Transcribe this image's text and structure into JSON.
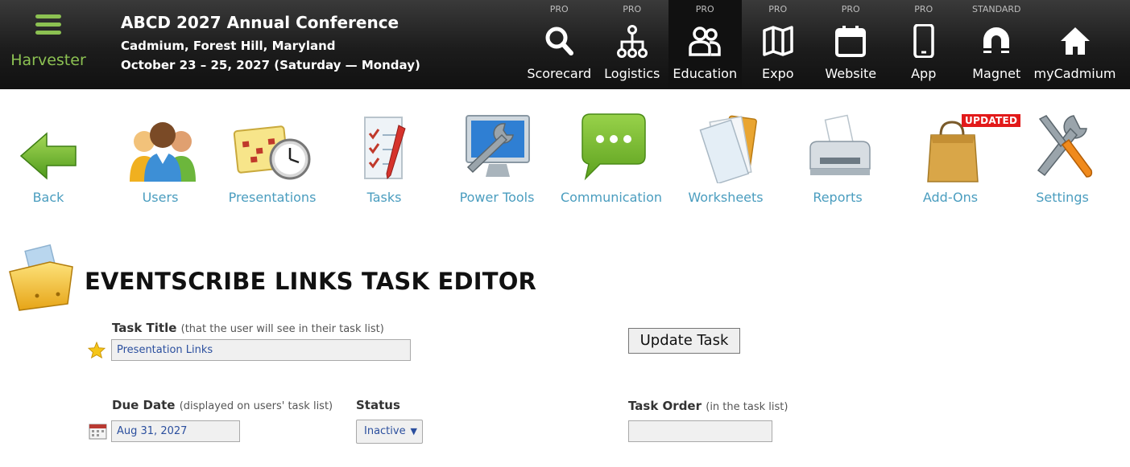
{
  "brand": {
    "name": "Harvester"
  },
  "event": {
    "title": "ABCD 2027 Annual Conference",
    "location": "Cadmium, Forest Hill, Maryland",
    "dates": "October 23 – 25, 2027 (Saturday — Monday)"
  },
  "nav": [
    {
      "tier": "PRO",
      "label": "Scorecard",
      "icon": "search-icon"
    },
    {
      "tier": "PRO",
      "label": "Logistics",
      "icon": "org-chart-icon"
    },
    {
      "tier": "PRO",
      "label": "Education",
      "icon": "people-icon",
      "active": true
    },
    {
      "tier": "PRO",
      "label": "Expo",
      "icon": "map-icon"
    },
    {
      "tier": "PRO",
      "label": "Website",
      "icon": "calendar-icon"
    },
    {
      "tier": "PRO",
      "label": "App",
      "icon": "phone-icon"
    },
    {
      "tier": "STANDARD",
      "label": "Magnet",
      "icon": "magnet-icon"
    },
    {
      "tier": "",
      "label": "myCadmium",
      "icon": "home-icon"
    }
  ],
  "toolbar": [
    {
      "label": "Back",
      "icon": "back-arrow-icon"
    },
    {
      "label": "Users",
      "icon": "users-icon"
    },
    {
      "label": "Presentations",
      "icon": "calendar-clock-icon"
    },
    {
      "label": "Tasks",
      "icon": "checklist-icon"
    },
    {
      "label": "Power Tools",
      "icon": "monitor-wrench-icon"
    },
    {
      "label": "Communication",
      "icon": "chat-bubble-icon"
    },
    {
      "label": "Worksheets",
      "icon": "documents-icon"
    },
    {
      "label": "Reports",
      "icon": "printer-icon"
    },
    {
      "label": "Add-Ons",
      "icon": "shopping-bag-icon",
      "badge": "UPDATED"
    },
    {
      "label": "Settings",
      "icon": "tools-icon"
    }
  ],
  "editor": {
    "title": "EVENTSCRIBE LINKS TASK EDITOR",
    "task_title_label": "Task Title",
    "task_title_hint": "(that the user will see in their task list)",
    "task_title_value": "Presentation Links",
    "update_button": "Update Task",
    "due_date_label": "Due Date",
    "due_date_hint": "(displayed on users' task list)",
    "due_date_value": "Aug 31, 2027",
    "status_label": "Status",
    "status_value": "Inactive",
    "task_order_label": "Task Order",
    "task_order_hint": "(in the task list)",
    "task_order_value": ""
  }
}
